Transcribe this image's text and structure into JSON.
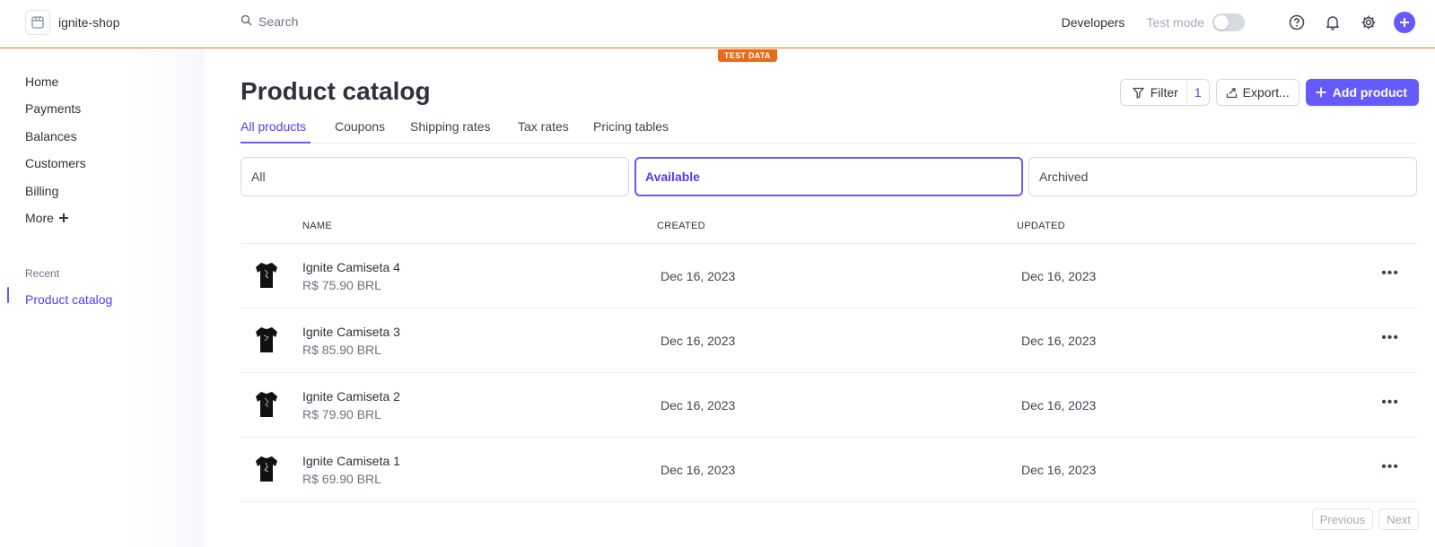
{
  "topbar": {
    "account_name": "ignite-shop",
    "search_placeholder": "Search",
    "developers": "Developers",
    "test_mode_label": "Test mode",
    "test_mode_on": false
  },
  "badge": {
    "test_data": "TEST DATA"
  },
  "sidebar": {
    "items": [
      {
        "label": "Home"
      },
      {
        "label": "Payments"
      },
      {
        "label": "Balances"
      },
      {
        "label": "Customers"
      },
      {
        "label": "Billing"
      },
      {
        "label": "More"
      }
    ],
    "recent_label": "Recent",
    "recent_items": [
      {
        "label": "Product catalog"
      }
    ]
  },
  "main": {
    "title": "Product catalog",
    "filter_label": "Filter",
    "filter_count": "1",
    "export_label": "Export...",
    "add_label": "Add product",
    "tabs": [
      {
        "label": "All products"
      },
      {
        "label": "Coupons"
      },
      {
        "label": "Shipping rates"
      },
      {
        "label": "Tax rates"
      },
      {
        "label": "Pricing tables"
      }
    ],
    "segments": [
      {
        "label": "All"
      },
      {
        "label": "Available"
      },
      {
        "label": "Archived"
      }
    ],
    "columns": {
      "name": "NAME",
      "created": "CREATED",
      "updated": "UPDATED"
    },
    "rows": [
      {
        "name": "Ignite Camiseta 4",
        "price": "R$ 75.90 BRL",
        "created": "Dec 16, 2023",
        "updated": "Dec 16, 2023"
      },
      {
        "name": "Ignite Camiseta 3",
        "price": "R$ 85.90 BRL",
        "created": "Dec 16, 2023",
        "updated": "Dec 16, 2023"
      },
      {
        "name": "Ignite Camiseta 2",
        "price": "R$ 79.90 BRL",
        "created": "Dec 16, 2023",
        "updated": "Dec 16, 2023"
      },
      {
        "name": "Ignite Camiseta 1",
        "price": "R$ 69.90 BRL",
        "created": "Dec 16, 2023",
        "updated": "Dec 16, 2023"
      }
    ],
    "pager": {
      "previous": "Previous",
      "next": "Next"
    }
  },
  "colors": {
    "accent": "#635bff",
    "accent_text": "#533afd",
    "test_orange": "#e66b1a"
  }
}
